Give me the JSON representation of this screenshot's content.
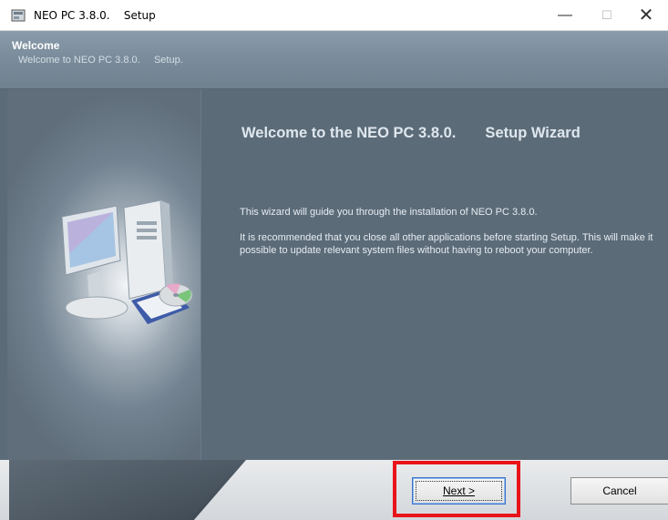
{
  "window": {
    "title": "NEO PC 3.8.0.    Setup"
  },
  "header": {
    "title": "Welcome",
    "subtitle": "Welcome to NEO PC 3.8.0.     Setup."
  },
  "main": {
    "heading": "Welcome to the NEO PC 3.8.0.       Setup Wizard",
    "paragraph1": "This wizard will guide you through the installation of NEO PC 3.8.0.",
    "paragraph2": "It is recommended that you close all other applications before starting Setup. This will make it\npossible to update relevant system files without having to reboot your computer."
  },
  "buttons": {
    "next_label": "Next >",
    "cancel_label": "Cancel"
  },
  "icons": {
    "app": "installer-icon",
    "illustration": "computer-with-disc-illustration"
  },
  "colors": {
    "highlight": "#e8141a",
    "panel": "#5c6b78"
  }
}
